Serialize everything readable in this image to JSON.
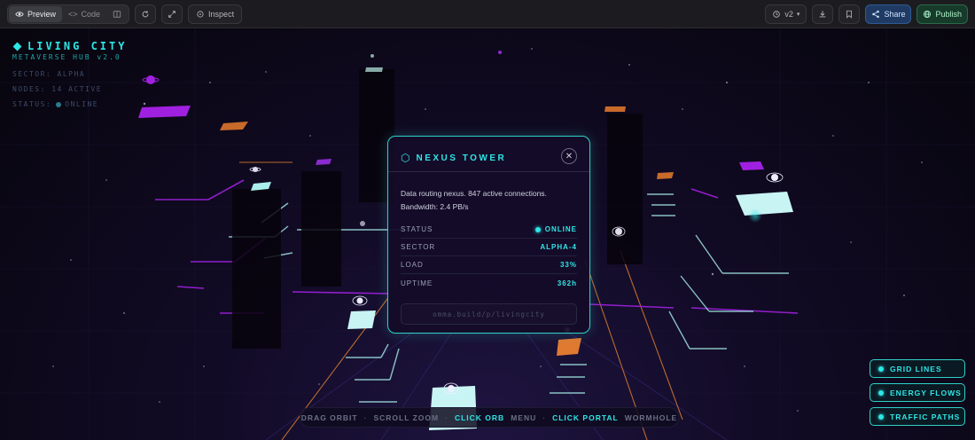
{
  "toolbar": {
    "preview_label": "Preview",
    "code_label": "Code",
    "inspect_label": "Inspect",
    "version_label": "v2",
    "share_label": "Share",
    "publish_label": "Publish"
  },
  "hud": {
    "title": "LIVING CITY",
    "subtitle": "METAVERSE HUB v2.0",
    "sector": "SECTOR: ALPHA",
    "nodes": "NODES: 14 ACTIVE",
    "status_prefix": "STATUS:",
    "status_value": "ONLINE"
  },
  "panel": {
    "title": "NEXUS TOWER",
    "description_line1": "Data routing nexus. 847 active connections.",
    "description_line2": "Bandwidth: 2.4 PB/s",
    "stats": [
      {
        "label": "STATUS",
        "value": "ONLINE"
      },
      {
        "label": "SECTOR",
        "value": "ALPHA-4"
      },
      {
        "label": "LOAD",
        "value": "33%"
      },
      {
        "label": "UPTIME",
        "value": "362h"
      }
    ],
    "link": "omma.build/p/livingcity"
  },
  "hints": {
    "drag": "DRAG ORBIT",
    "scroll": "SCROLL ZOOM",
    "click_orb": "CLICK ORB",
    "menu": "MENU",
    "click_portal": "CLICK PORTAL",
    "wormhole": "WORMHOLE"
  },
  "toggles": {
    "grid": "GRID LINES",
    "energy": "ENERGY FLOWS",
    "traffic": "TRAFFIC PATHS"
  },
  "colors": {
    "accent": "#2ee6e6",
    "purple": "#a020e0",
    "orange": "#d87a30",
    "background": "#0a0712"
  }
}
